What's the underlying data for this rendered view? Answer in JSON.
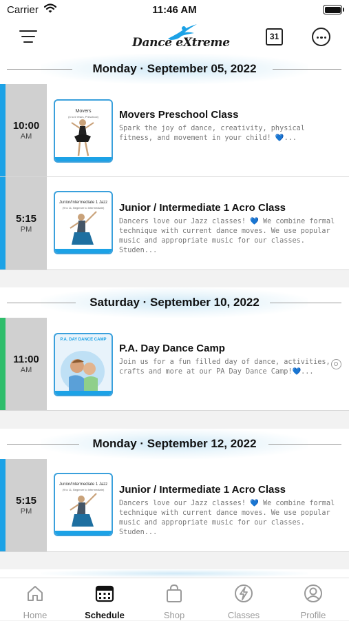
{
  "status_bar": {
    "carrier": "Carrier",
    "time": "11:46 AM"
  },
  "nav": {
    "logo_text": "Dance eXtreme",
    "calendar_day": "31",
    "menu_icon": "hamburger-menu-icon",
    "more_icon": "more-options-icon"
  },
  "colors": {
    "accent_blue": "#1ca2e6",
    "accent_green": "#2ebd6b",
    "time_column": "#d0d0d0"
  },
  "days": [
    {
      "label": "Monday · September 05, 2022",
      "events": [
        {
          "time": "10:00",
          "ampm": "AM",
          "stripe": "#1ca2e6",
          "title": "Movers Preschool Class",
          "description": "Spark the joy of dance, creativity, physical fitness, and movement in your child! 💙...",
          "thumb": {
            "heading": "Movers",
            "sub": "(3 to 6 Years, Preschool)"
          }
        },
        {
          "time": "5:15",
          "ampm": "PM",
          "stripe": "#1ca2e6",
          "title": "Junior / Intermediate 1 Acro Class",
          "description": "Dancers love our Jazz classes! 💙 We combine formal technique with current dance moves. We use popular music and appropriate music for our classes. Studen...",
          "thumb": {
            "heading": "Junior/Intermediate 1 Jazz",
            "sub": "(9 to 11, Beginner to Intermediate)"
          }
        }
      ]
    },
    {
      "label": "Saturday · September 10, 2022",
      "events": [
        {
          "time": "11:00",
          "ampm": "AM",
          "stripe": "#2ebd6b",
          "title": "P.A. Day Dance Camp",
          "description": "Join us for a fun filled day of dance, activities, crafts and more at our PA Day Dance Camp!💙...",
          "thumb": {
            "heading": "P.A. DAY DANCE CAMP",
            "sub": ""
          }
        }
      ]
    },
    {
      "label": "Monday · September 12, 2022",
      "events": [
        {
          "time": "5:15",
          "ampm": "PM",
          "stripe": "#1ca2e6",
          "title": "Junior / Intermediate 1 Acro Class",
          "description": "Dancers love our Jazz classes! 💙 We combine formal technique with current dance moves. We use popular music and appropriate music for our classes. Studen...",
          "thumb": {
            "heading": "Junior/Intermediate 1 Jazz",
            "sub": "(9 to 11, Beginner to Intermediate)"
          }
        }
      ]
    }
  ],
  "tabs": [
    {
      "label": "Home",
      "icon": "home-icon",
      "active": false
    },
    {
      "label": "Schedule",
      "icon": "calendar-icon",
      "active": true
    },
    {
      "label": "Shop",
      "icon": "shopping-bag-icon",
      "active": false
    },
    {
      "label": "Classes",
      "icon": "lightning-icon",
      "active": false
    },
    {
      "label": "Profile",
      "icon": "profile-icon",
      "active": false
    }
  ]
}
